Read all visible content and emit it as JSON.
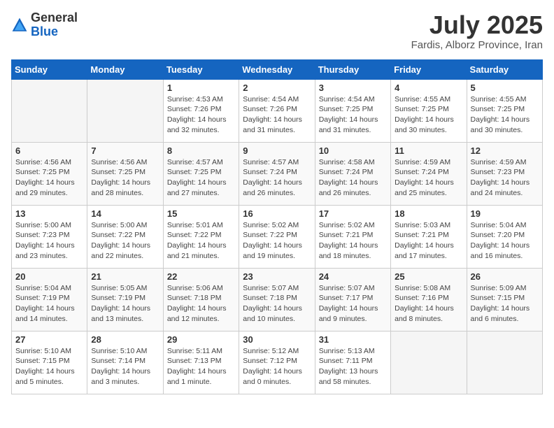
{
  "header": {
    "logo_general": "General",
    "logo_blue": "Blue",
    "title": "July 2025",
    "location": "Fardis, Alborz Province, Iran"
  },
  "weekdays": [
    "Sunday",
    "Monday",
    "Tuesday",
    "Wednesday",
    "Thursday",
    "Friday",
    "Saturday"
  ],
  "weeks": [
    [
      {
        "day": "",
        "info": ""
      },
      {
        "day": "",
        "info": ""
      },
      {
        "day": "1",
        "info": "Sunrise: 4:53 AM\nSunset: 7:26 PM\nDaylight: 14 hours and 32 minutes."
      },
      {
        "day": "2",
        "info": "Sunrise: 4:54 AM\nSunset: 7:26 PM\nDaylight: 14 hours and 31 minutes."
      },
      {
        "day": "3",
        "info": "Sunrise: 4:54 AM\nSunset: 7:25 PM\nDaylight: 14 hours and 31 minutes."
      },
      {
        "day": "4",
        "info": "Sunrise: 4:55 AM\nSunset: 7:25 PM\nDaylight: 14 hours and 30 minutes."
      },
      {
        "day": "5",
        "info": "Sunrise: 4:55 AM\nSunset: 7:25 PM\nDaylight: 14 hours and 30 minutes."
      }
    ],
    [
      {
        "day": "6",
        "info": "Sunrise: 4:56 AM\nSunset: 7:25 PM\nDaylight: 14 hours and 29 minutes."
      },
      {
        "day": "7",
        "info": "Sunrise: 4:56 AM\nSunset: 7:25 PM\nDaylight: 14 hours and 28 minutes."
      },
      {
        "day": "8",
        "info": "Sunrise: 4:57 AM\nSunset: 7:25 PM\nDaylight: 14 hours and 27 minutes."
      },
      {
        "day": "9",
        "info": "Sunrise: 4:57 AM\nSunset: 7:24 PM\nDaylight: 14 hours and 26 minutes."
      },
      {
        "day": "10",
        "info": "Sunrise: 4:58 AM\nSunset: 7:24 PM\nDaylight: 14 hours and 26 minutes."
      },
      {
        "day": "11",
        "info": "Sunrise: 4:59 AM\nSunset: 7:24 PM\nDaylight: 14 hours and 25 minutes."
      },
      {
        "day": "12",
        "info": "Sunrise: 4:59 AM\nSunset: 7:23 PM\nDaylight: 14 hours and 24 minutes."
      }
    ],
    [
      {
        "day": "13",
        "info": "Sunrise: 5:00 AM\nSunset: 7:23 PM\nDaylight: 14 hours and 23 minutes."
      },
      {
        "day": "14",
        "info": "Sunrise: 5:00 AM\nSunset: 7:22 PM\nDaylight: 14 hours and 22 minutes."
      },
      {
        "day": "15",
        "info": "Sunrise: 5:01 AM\nSunset: 7:22 PM\nDaylight: 14 hours and 21 minutes."
      },
      {
        "day": "16",
        "info": "Sunrise: 5:02 AM\nSunset: 7:22 PM\nDaylight: 14 hours and 19 minutes."
      },
      {
        "day": "17",
        "info": "Sunrise: 5:02 AM\nSunset: 7:21 PM\nDaylight: 14 hours and 18 minutes."
      },
      {
        "day": "18",
        "info": "Sunrise: 5:03 AM\nSunset: 7:21 PM\nDaylight: 14 hours and 17 minutes."
      },
      {
        "day": "19",
        "info": "Sunrise: 5:04 AM\nSunset: 7:20 PM\nDaylight: 14 hours and 16 minutes."
      }
    ],
    [
      {
        "day": "20",
        "info": "Sunrise: 5:04 AM\nSunset: 7:19 PM\nDaylight: 14 hours and 14 minutes."
      },
      {
        "day": "21",
        "info": "Sunrise: 5:05 AM\nSunset: 7:19 PM\nDaylight: 14 hours and 13 minutes."
      },
      {
        "day": "22",
        "info": "Sunrise: 5:06 AM\nSunset: 7:18 PM\nDaylight: 14 hours and 12 minutes."
      },
      {
        "day": "23",
        "info": "Sunrise: 5:07 AM\nSunset: 7:18 PM\nDaylight: 14 hours and 10 minutes."
      },
      {
        "day": "24",
        "info": "Sunrise: 5:07 AM\nSunset: 7:17 PM\nDaylight: 14 hours and 9 minutes."
      },
      {
        "day": "25",
        "info": "Sunrise: 5:08 AM\nSunset: 7:16 PM\nDaylight: 14 hours and 8 minutes."
      },
      {
        "day": "26",
        "info": "Sunrise: 5:09 AM\nSunset: 7:15 PM\nDaylight: 14 hours and 6 minutes."
      }
    ],
    [
      {
        "day": "27",
        "info": "Sunrise: 5:10 AM\nSunset: 7:15 PM\nDaylight: 14 hours and 5 minutes."
      },
      {
        "day": "28",
        "info": "Sunrise: 5:10 AM\nSunset: 7:14 PM\nDaylight: 14 hours and 3 minutes."
      },
      {
        "day": "29",
        "info": "Sunrise: 5:11 AM\nSunset: 7:13 PM\nDaylight: 14 hours and 1 minute."
      },
      {
        "day": "30",
        "info": "Sunrise: 5:12 AM\nSunset: 7:12 PM\nDaylight: 14 hours and 0 minutes."
      },
      {
        "day": "31",
        "info": "Sunrise: 5:13 AM\nSunset: 7:11 PM\nDaylight: 13 hours and 58 minutes."
      },
      {
        "day": "",
        "info": ""
      },
      {
        "day": "",
        "info": ""
      }
    ]
  ]
}
